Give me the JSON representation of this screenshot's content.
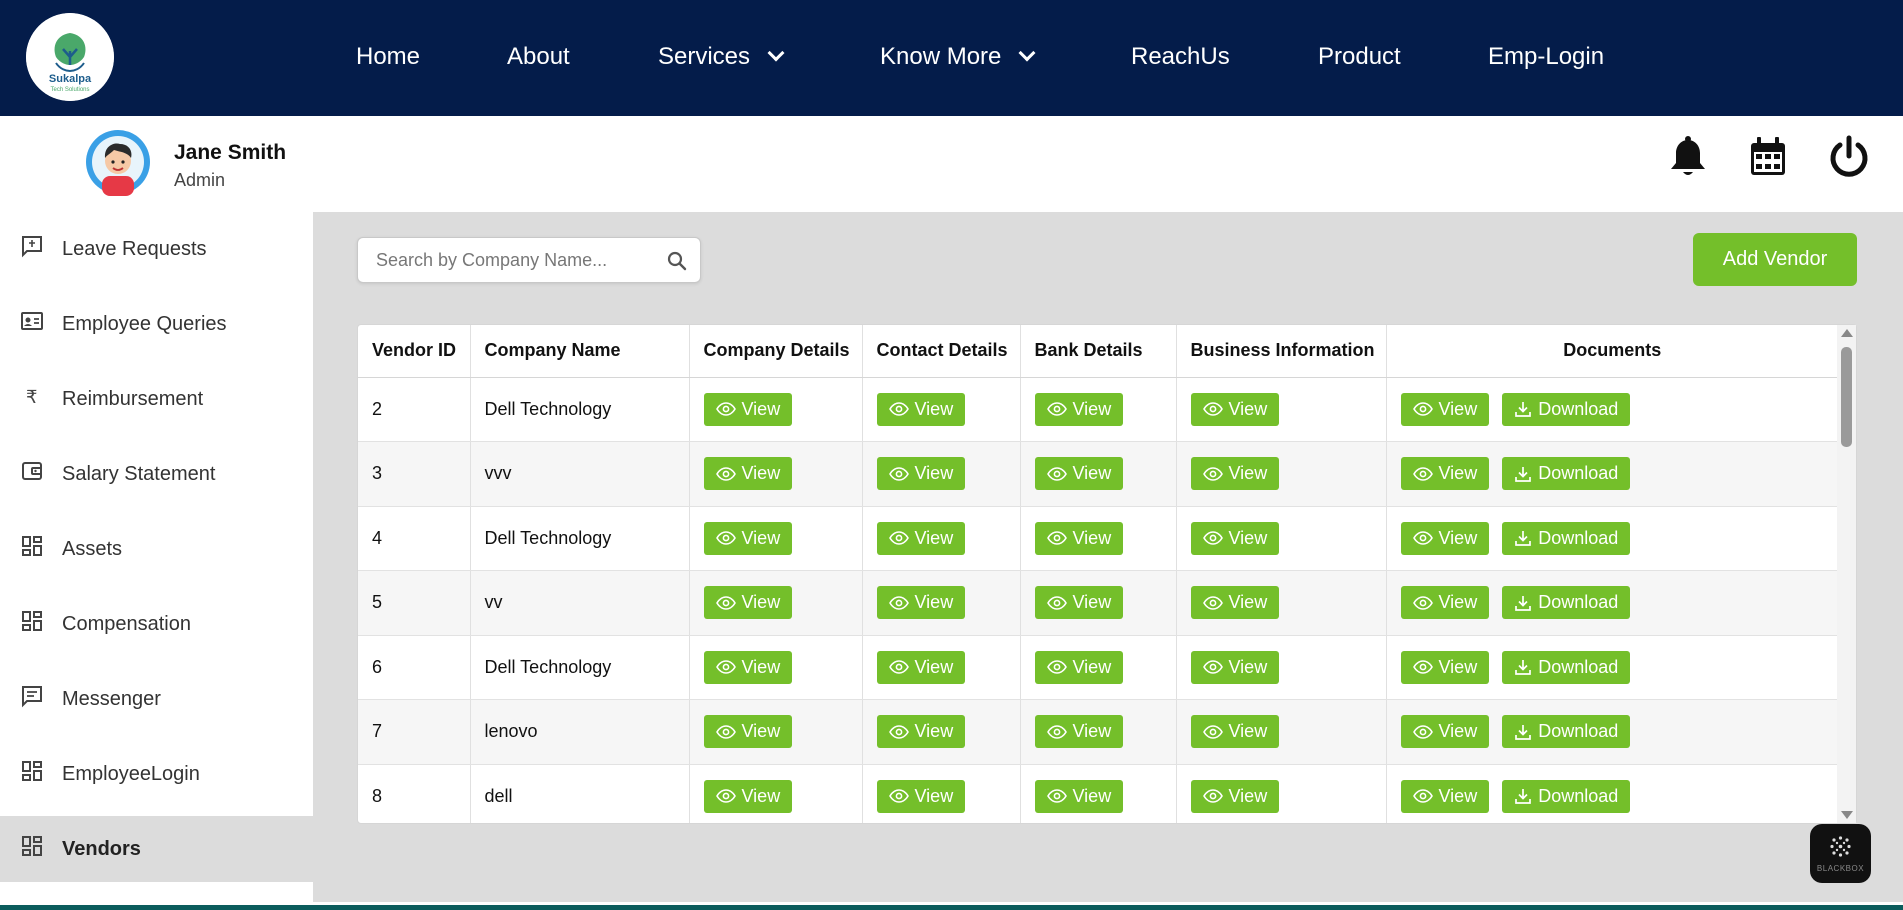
{
  "brand": {
    "logo_name": "Sukalpa",
    "logo_tagline": "Tech Solutions"
  },
  "nav": {
    "items": [
      {
        "label": "Home"
      },
      {
        "label": "About"
      },
      {
        "label": "Services"
      },
      {
        "label": "Know More"
      },
      {
        "label": "ReachUs"
      },
      {
        "label": "Product"
      },
      {
        "label": "Emp-Login"
      }
    ]
  },
  "user": {
    "name": "Jane Smith",
    "role": "Admin"
  },
  "header_icons": [
    "bell-icon",
    "calendar-icon",
    "power-icon"
  ],
  "sidebar": {
    "items": [
      {
        "label": "Leave Requests",
        "icon": "leave-icon"
      },
      {
        "label": "Employee Queries",
        "icon": "id-card-icon"
      },
      {
        "label": "Reimbursement",
        "icon": "rupee-icon"
      },
      {
        "label": "Salary Statement",
        "icon": "wallet-icon"
      },
      {
        "label": "Assets",
        "icon": "dashboard-icon"
      },
      {
        "label": "Compensation",
        "icon": "dashboard-icon"
      },
      {
        "label": "Messenger",
        "icon": "message-icon"
      },
      {
        "label": "EmployeeLogin",
        "icon": "dashboard-icon"
      },
      {
        "label": "Vendors",
        "icon": "dashboard-icon",
        "active": true
      }
    ]
  },
  "search": {
    "placeholder": "Search by Company Name...",
    "value": ""
  },
  "add_vendor_label": "Add Vendor",
  "table": {
    "headers": [
      "Vendor ID",
      "Company Name",
      "Company Details",
      "Contact Details",
      "Bank Details",
      "Business Information",
      "Documents"
    ],
    "view_label": "View",
    "download_label": "Download",
    "rows": [
      {
        "id": "2",
        "company": "Dell Technology"
      },
      {
        "id": "3",
        "company": "vvv"
      },
      {
        "id": "4",
        "company": "Dell Technology"
      },
      {
        "id": "5",
        "company": "vv"
      },
      {
        "id": "6",
        "company": "Dell Technology"
      },
      {
        "id": "7",
        "company": "lenovo"
      },
      {
        "id": "8",
        "company": "dell"
      }
    ]
  },
  "widget": {
    "label": "BLACKBOX"
  },
  "colors": {
    "nav_bg": "#041c4a",
    "accent": "#74bf2a",
    "content_bg": "#dcdcdc"
  }
}
